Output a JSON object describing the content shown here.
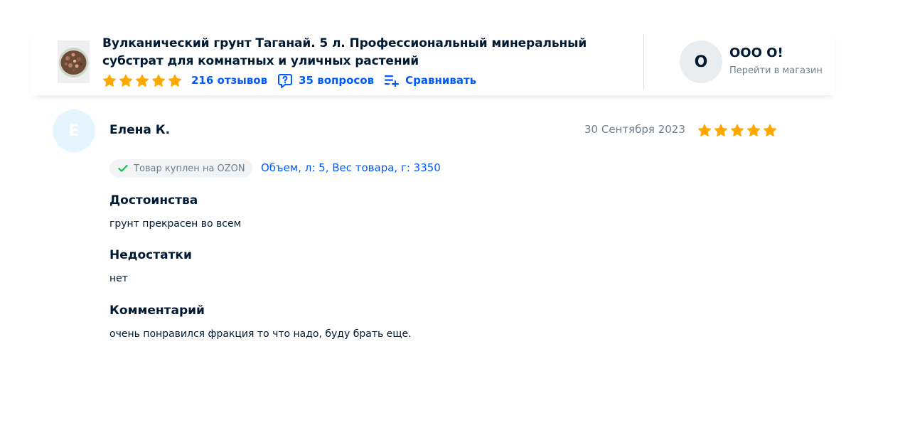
{
  "product": {
    "title": "Вулканический грунт Таганай. 5 л. Профессиональный минеральный субстрат для комнатных и уличных растений",
    "rating": 5,
    "reviews_label": "216 отзывов",
    "questions_label": "35 вопросов",
    "compare_label": "Сравнивать",
    "star_color": "#ffa800",
    "link_color": "#005bff"
  },
  "shop": {
    "avatar_letter": "О",
    "name": "ООО О!",
    "link_label": "Перейти в магазин"
  },
  "review": {
    "avatar_letter": "Е",
    "author": "Елена К.",
    "date": "30 Сентября 2023",
    "rating": 5,
    "purchased_badge": "Товар куплен на OZON",
    "variant": "Объем, л: 5, Вес товара, г: 3350",
    "sections": [
      {
        "title": "Достоинства",
        "text": "грунт прекрасен во всем"
      },
      {
        "title": "Недостатки",
        "text": "нет"
      },
      {
        "title": "Комментарий",
        "text": "очень понравился фракция то что надо, буду брать еще."
      }
    ]
  }
}
